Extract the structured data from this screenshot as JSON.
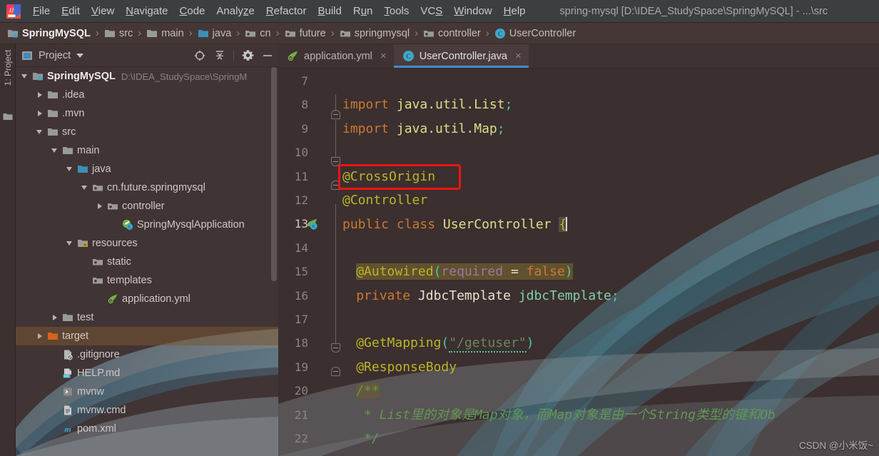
{
  "window": {
    "title": "spring-mysql [D:\\IDEA_StudySpace\\SpringMySQL] - ...\\src",
    "logo_icon": "intellij-idea-logo"
  },
  "menubar": {
    "items": [
      {
        "label": "File",
        "mnemonic": "F"
      },
      {
        "label": "Edit",
        "mnemonic": "E"
      },
      {
        "label": "View",
        "mnemonic": "V"
      },
      {
        "label": "Navigate",
        "mnemonic": "N"
      },
      {
        "label": "Code",
        "mnemonic": "C"
      },
      {
        "label": "Analyze",
        "mnemonic": "z"
      },
      {
        "label": "Refactor",
        "mnemonic": "R"
      },
      {
        "label": "Build",
        "mnemonic": "B"
      },
      {
        "label": "Run",
        "mnemonic": "u"
      },
      {
        "label": "Tools",
        "mnemonic": "T"
      },
      {
        "label": "VCS",
        "mnemonic": "S"
      },
      {
        "label": "Window",
        "mnemonic": "W"
      },
      {
        "label": "Help",
        "mnemonic": "H"
      }
    ]
  },
  "breadcrumb": {
    "separator": "›",
    "items": [
      {
        "label": "SpringMySQL",
        "icon": "module-icon",
        "root": true
      },
      {
        "label": "src",
        "icon": "folder-icon"
      },
      {
        "label": "main",
        "icon": "folder-icon"
      },
      {
        "label": "java",
        "icon": "source-root-icon"
      },
      {
        "label": "cn",
        "icon": "package-icon"
      },
      {
        "label": "future",
        "icon": "package-icon"
      },
      {
        "label": "springmysql",
        "icon": "package-icon"
      },
      {
        "label": "controller",
        "icon": "package-icon"
      },
      {
        "label": "UserController",
        "icon": "java-class-icon"
      }
    ]
  },
  "left_toolbar": {
    "tab_label": "1: Project",
    "folder_icon": "folder-icon"
  },
  "project_panel": {
    "title": "Project",
    "caret_icon": "chevron-down-icon",
    "tools": [
      {
        "name": "locate-icon",
        "title": "Select Opened File"
      },
      {
        "name": "collapse-all-icon",
        "title": "Collapse All"
      },
      {
        "name": "gear-icon",
        "title": "Settings"
      },
      {
        "name": "minimize-icon",
        "title": "Hide"
      }
    ],
    "tree": [
      {
        "label": "SpringMySQL",
        "path": "D:\\IDEA_StudySpace\\SpringM",
        "depth": 0,
        "arrow": "expanded",
        "icon": "module-icon",
        "root": true
      },
      {
        "label": ".idea",
        "depth": 1,
        "arrow": "collapsed",
        "icon": "folder-icon"
      },
      {
        "label": ".mvn",
        "depth": 1,
        "arrow": "collapsed",
        "icon": "folder-icon"
      },
      {
        "label": "src",
        "depth": 1,
        "arrow": "expanded",
        "icon": "folder-icon"
      },
      {
        "label": "main",
        "depth": 2,
        "arrow": "expanded",
        "icon": "folder-icon"
      },
      {
        "label": "java",
        "depth": 3,
        "arrow": "expanded",
        "icon": "source-root-icon"
      },
      {
        "label": "cn.future.springmysql",
        "depth": 4,
        "arrow": "expanded",
        "icon": "package-icon"
      },
      {
        "label": "controller",
        "depth": 5,
        "arrow": "collapsed",
        "icon": "package-icon"
      },
      {
        "label": "SpringMysqlApplication",
        "depth": 6,
        "arrow": "none",
        "icon": "spring-class-icon"
      },
      {
        "label": "resources",
        "depth": 3,
        "arrow": "expanded",
        "icon": "resource-root-icon"
      },
      {
        "label": "static",
        "depth": 4,
        "arrow": "none",
        "icon": "package-icon"
      },
      {
        "label": "templates",
        "depth": 4,
        "arrow": "none",
        "icon": "package-icon"
      },
      {
        "label": "application.yml",
        "depth": 5,
        "arrow": "none",
        "icon": "spring-yml-icon"
      },
      {
        "label": "test",
        "depth": 2,
        "arrow": "collapsed",
        "icon": "folder-icon"
      },
      {
        "label": "target",
        "depth": 1,
        "arrow": "collapsed",
        "icon": "excluded-folder-icon",
        "selected": true
      },
      {
        "label": ".gitignore",
        "depth": 2,
        "arrow": "none",
        "icon": "gitignore-icon"
      },
      {
        "label": "HELP.md",
        "depth": 2,
        "arrow": "none",
        "icon": "markdown-icon"
      },
      {
        "label": "mvnw",
        "depth": 2,
        "arrow": "none",
        "icon": "shell-script-icon"
      },
      {
        "label": "mvnw.cmd",
        "depth": 2,
        "arrow": "none",
        "icon": "cmd-file-icon"
      },
      {
        "label": "pom.xml",
        "depth": 2,
        "arrow": "none",
        "icon": "maven-icon"
      }
    ]
  },
  "editor": {
    "tabs": [
      {
        "label": "application.yml",
        "icon": "spring-yml-icon",
        "active": false,
        "close_icon": "close-icon"
      },
      {
        "label": "UserController.java",
        "icon": "java-class-icon",
        "active": true,
        "close_icon": "close-icon"
      }
    ],
    "first_line": 7,
    "lines": [
      {
        "num": 7,
        "segments": []
      },
      {
        "num": 8,
        "segments": [
          {
            "t": "import ",
            "c": "t-kw"
          },
          {
            "t": "java.util.List",
            "c": "t-cls"
          },
          {
            "t": ";",
            "c": "t-grn"
          }
        ]
      },
      {
        "num": 9,
        "segments": [
          {
            "t": "import ",
            "c": "t-kw"
          },
          {
            "t": "java.util.Map",
            "c": "t-cls"
          },
          {
            "t": ";",
            "c": "t-grn"
          }
        ]
      },
      {
        "num": 10,
        "segments": []
      },
      {
        "num": 11,
        "segments": [
          {
            "t": "@CrossOrigin",
            "c": "t-ann"
          }
        ],
        "highlight_box": true
      },
      {
        "num": 12,
        "segments": [
          {
            "t": "@Controller",
            "c": "t-ann"
          }
        ]
      },
      {
        "num": 13,
        "segments": [
          {
            "t": "public ",
            "c": "t-kw"
          },
          {
            "t": "class ",
            "c": "t-kw"
          },
          {
            "t": "UserController ",
            "c": "t-cls"
          },
          {
            "t": "{",
            "c": "t-ann brace-hl"
          }
        ],
        "gutter_icon": "spring-bean-icon",
        "caret_after": true
      },
      {
        "num": 14,
        "segments": []
      },
      {
        "num": 15,
        "segments": [
          {
            "t": "@Autowired",
            "c": "t-ann"
          },
          {
            "t": "(",
            "c": "t-grn"
          },
          {
            "t": "required",
            "c": "t-field"
          },
          {
            "t": " = ",
            "c": "t-white"
          },
          {
            "t": "false",
            "c": "t-kw"
          },
          {
            "t": ")",
            "c": "t-grn"
          }
        ],
        "indent": 2,
        "row_highlight": "autowired"
      },
      {
        "num": 16,
        "segments": [
          {
            "t": "private ",
            "c": "t-kw"
          },
          {
            "t": "JdbcTemplate ",
            "c": "t-white"
          },
          {
            "t": "jdbcTemplate",
            "c": "t-var"
          },
          {
            "t": ";",
            "c": "t-grn"
          }
        ],
        "indent": 2
      },
      {
        "num": 17,
        "segments": []
      },
      {
        "num": 18,
        "segments": [
          {
            "t": "@GetMapping",
            "c": "t-ann"
          },
          {
            "t": "(",
            "c": "t-grn"
          },
          {
            "t": "\"/getuser\"",
            "c": "t-str squiggle"
          },
          {
            "t": ")",
            "c": "t-grn"
          }
        ],
        "indent": 2
      },
      {
        "num": 19,
        "segments": [
          {
            "t": "@ResponseBody",
            "c": "t-ann"
          }
        ],
        "indent": 2
      },
      {
        "num": 20,
        "segments": [
          {
            "t": "/**",
            "c": "t-cmt hl-doc"
          }
        ],
        "indent": 2
      },
      {
        "num": 21,
        "segments": [
          {
            "t": " * List里的对象是Map对象，而Map对象是由一个String类型的键和Ob",
            "c": "t-cmt"
          }
        ],
        "indent": 2
      },
      {
        "num": 22,
        "segments": [
          {
            "t": " */",
            "c": "t-cmt"
          }
        ],
        "indent": 2
      }
    ]
  },
  "watermark": {
    "text": "CSDN @小米饭~"
  },
  "colors": {
    "accent_blue": "#4a88c7",
    "annotation_yellow": "#bbb529",
    "keyword_orange": "#cc7832",
    "string_green": "#6a8759",
    "comment_green": "#629755",
    "highlight_red": "#f41414",
    "selected_row": "#6f4f2f",
    "panel_bg": "#413434",
    "editor_bg": "#3b2f2f"
  }
}
